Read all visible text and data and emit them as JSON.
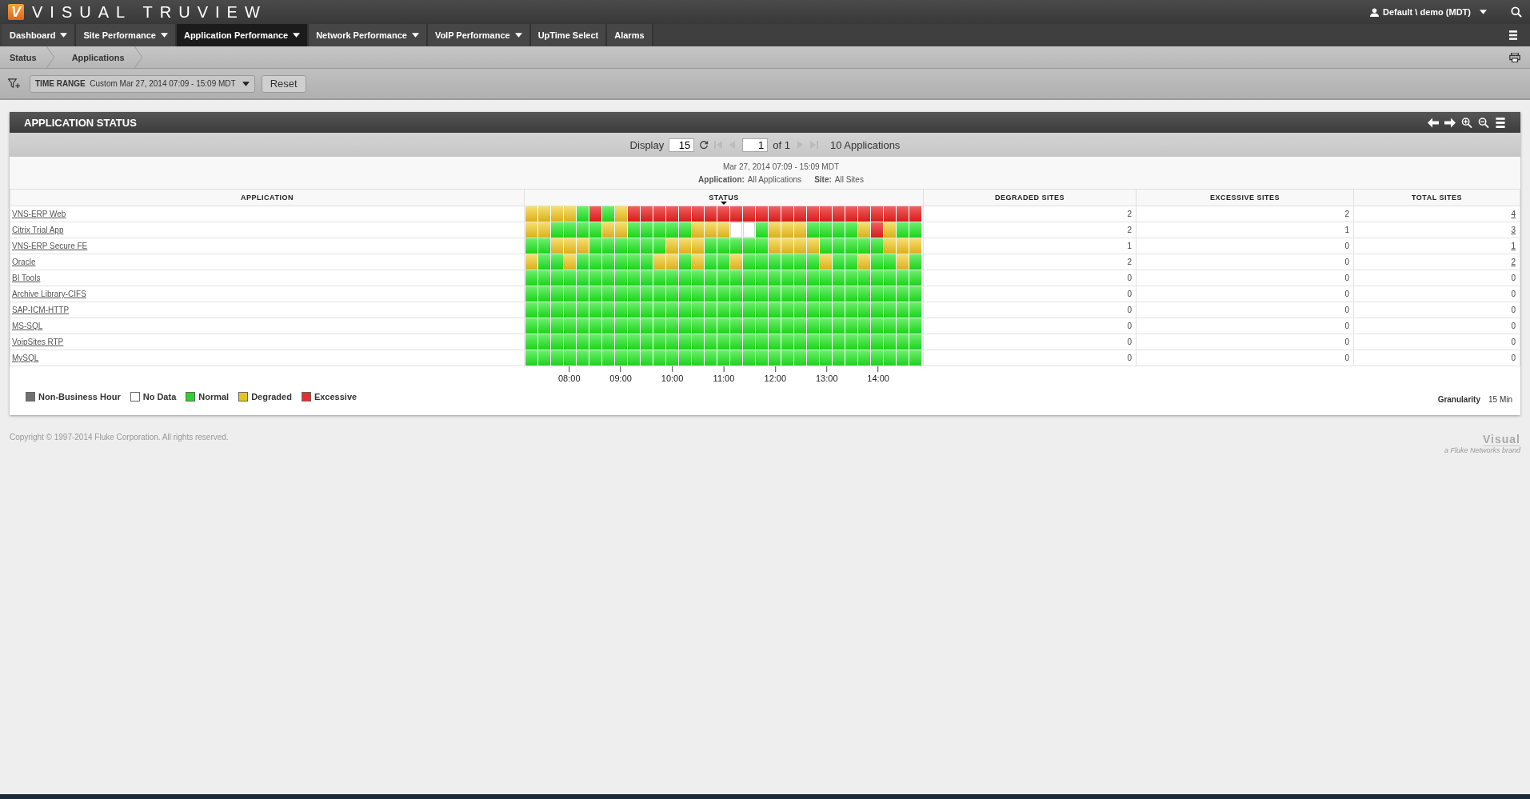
{
  "brand": {
    "logo_letter": "V",
    "title": "VISUAL TRUVIEW"
  },
  "user": {
    "label": "Default \\ demo (MDT)"
  },
  "nav": [
    {
      "label": "Dashboard",
      "dropdown": true,
      "selected": false
    },
    {
      "label": "Site Performance",
      "dropdown": true,
      "selected": false
    },
    {
      "label": "Application Performance",
      "dropdown": true,
      "selected": true
    },
    {
      "label": "Network Performance",
      "dropdown": true,
      "selected": false
    },
    {
      "label": "VoIP Performance",
      "dropdown": true,
      "selected": false
    },
    {
      "label": "UpTime Select",
      "dropdown": false,
      "selected": false
    },
    {
      "label": "Alarms",
      "dropdown": false,
      "selected": false
    }
  ],
  "breadcrumb": [
    "Status",
    "Applications"
  ],
  "filter": {
    "label": "TIME RANGE",
    "value": "Custom Mar 27, 2014 07:09 - 15:09 MDT",
    "reset": "Reset"
  },
  "panel": {
    "title": "APPLICATION STATUS",
    "pager": {
      "display_label": "Display",
      "display_value": "15",
      "page_value": "1",
      "page_of": "of 1",
      "count": "10 Applications"
    },
    "info": {
      "date": "Mar 27, 2014 07:09 - 15:09 MDT",
      "application_label": "Application:",
      "application_value": "All Applications",
      "site_label": "Site:",
      "site_value": "All Sites"
    },
    "columns": [
      "APPLICATION",
      "STATUS",
      "DEGRADED SITES",
      "EXCESSIVE SITES",
      "TOTAL SITES"
    ],
    "rows": [
      {
        "application": "VNS-ERP Web",
        "degraded": "2",
        "excessive": "2",
        "total": "4",
        "total_link": true,
        "cells": [
          {
            "kind": "degraded"
          },
          {
            "kind": "degraded"
          },
          {
            "kind": "degraded"
          },
          {
            "kind": "degraded"
          },
          {
            "kind": "normal"
          },
          {
            "kind": "excessive"
          },
          {
            "kind": "normal"
          },
          {
            "kind": "degraded"
          },
          {
            "kind": "excessive"
          },
          {
            "kind": "excessive"
          },
          {
            "kind": "excessive"
          },
          {
            "kind": "excessive"
          },
          {
            "kind": "excessive"
          },
          {
            "kind": "excessive"
          },
          {
            "kind": "excessive"
          },
          {
            "kind": "excessive"
          },
          {
            "kind": "excessive"
          },
          {
            "kind": "excessive"
          },
          {
            "kind": "excessive"
          },
          {
            "kind": "excessive"
          },
          {
            "kind": "excessive"
          },
          {
            "kind": "excessive"
          },
          {
            "kind": "excessive"
          },
          {
            "kind": "excessive"
          },
          {
            "kind": "excessive"
          },
          {
            "kind": "excessive"
          },
          {
            "kind": "excessive"
          },
          {
            "kind": "excessive"
          },
          {
            "kind": "excessive"
          },
          {
            "kind": "excessive"
          },
          {
            "kind": "excessive"
          }
        ]
      },
      {
        "application": "Citrix Trial App",
        "degraded": "2",
        "excessive": "1",
        "total": "3",
        "total_link": true,
        "cells": [
          {
            "kind": "degraded"
          },
          {
            "kind": "degraded"
          },
          {
            "kind": "normal"
          },
          {
            "kind": "normal"
          },
          {
            "kind": "normal"
          },
          {
            "kind": "normal"
          },
          {
            "kind": "degraded"
          },
          {
            "kind": "degraded"
          },
          {
            "kind": "normal"
          },
          {
            "kind": "normal"
          },
          {
            "kind": "normal"
          },
          {
            "kind": "normal"
          },
          {
            "kind": "normal"
          },
          {
            "kind": "degraded"
          },
          {
            "kind": "degraded"
          },
          {
            "kind": "degraded"
          },
          {
            "kind": "empty"
          },
          {
            "kind": "empty"
          },
          {
            "kind": "normal"
          },
          {
            "kind": "degraded"
          },
          {
            "kind": "degraded"
          },
          {
            "kind": "degraded"
          },
          {
            "kind": "normal"
          },
          {
            "kind": "normal"
          },
          {
            "kind": "normal"
          },
          {
            "kind": "normal"
          },
          {
            "kind": "degraded"
          },
          {
            "kind": "excessive"
          },
          {
            "kind": "degraded"
          },
          {
            "kind": "normal"
          },
          {
            "kind": "normal"
          }
        ]
      },
      {
        "application": "VNS-ERP Secure FE",
        "degraded": "1",
        "excessive": "0",
        "total": "1",
        "total_link": true,
        "cells": [
          {
            "kind": "normal"
          },
          {
            "kind": "normal"
          },
          {
            "kind": "degraded"
          },
          {
            "kind": "degraded"
          },
          {
            "kind": "degraded"
          },
          {
            "kind": "normal"
          },
          {
            "kind": "normal"
          },
          {
            "kind": "normal"
          },
          {
            "kind": "normal"
          },
          {
            "kind": "normal"
          },
          {
            "kind": "normal"
          },
          {
            "kind": "degraded"
          },
          {
            "kind": "degraded"
          },
          {
            "kind": "degraded"
          },
          {
            "kind": "normal"
          },
          {
            "kind": "normal"
          },
          {
            "kind": "normal"
          },
          {
            "kind": "normal"
          },
          {
            "kind": "normal"
          },
          {
            "kind": "degraded"
          },
          {
            "kind": "degraded"
          },
          {
            "kind": "degraded"
          },
          {
            "kind": "degraded"
          },
          {
            "kind": "normal"
          },
          {
            "kind": "normal"
          },
          {
            "kind": "normal"
          },
          {
            "kind": "normal"
          },
          {
            "kind": "normal"
          },
          {
            "kind": "degraded"
          },
          {
            "kind": "degraded"
          },
          {
            "kind": "degraded"
          }
        ]
      },
      {
        "application": "Oracle",
        "degraded": "2",
        "excessive": "0",
        "total": "2",
        "total_link": true,
        "cells": [
          {
            "kind": "degraded"
          },
          {
            "kind": "normal"
          },
          {
            "kind": "normal"
          },
          {
            "kind": "degraded"
          },
          {
            "kind": "normal"
          },
          {
            "kind": "normal"
          },
          {
            "kind": "normal"
          },
          {
            "kind": "normal"
          },
          {
            "kind": "normal"
          },
          {
            "kind": "normal"
          },
          {
            "kind": "degraded"
          },
          {
            "kind": "degraded"
          },
          {
            "kind": "normal"
          },
          {
            "kind": "degraded"
          },
          {
            "kind": "normal"
          },
          {
            "kind": "normal"
          },
          {
            "kind": "degraded"
          },
          {
            "kind": "normal"
          },
          {
            "kind": "normal"
          },
          {
            "kind": "normal"
          },
          {
            "kind": "normal"
          },
          {
            "kind": "normal"
          },
          {
            "kind": "normal"
          },
          {
            "kind": "degraded"
          },
          {
            "kind": "normal"
          },
          {
            "kind": "normal"
          },
          {
            "kind": "degraded"
          },
          {
            "kind": "normal"
          },
          {
            "kind": "normal"
          },
          {
            "kind": "degraded"
          },
          {
            "kind": "normal"
          }
        ]
      },
      {
        "application": "BI Tools",
        "degraded": "0",
        "excessive": "0",
        "total": "0",
        "total_link": false,
        "cells": [
          {
            "kind": "normal"
          },
          {
            "kind": "normal"
          },
          {
            "kind": "normal"
          },
          {
            "kind": "normal"
          },
          {
            "kind": "normal"
          },
          {
            "kind": "normal"
          },
          {
            "kind": "normal"
          },
          {
            "kind": "normal"
          },
          {
            "kind": "normal"
          },
          {
            "kind": "normal"
          },
          {
            "kind": "normal"
          },
          {
            "kind": "normal"
          },
          {
            "kind": "normal"
          },
          {
            "kind": "normal"
          },
          {
            "kind": "normal"
          },
          {
            "kind": "normal"
          },
          {
            "kind": "normal"
          },
          {
            "kind": "normal"
          },
          {
            "kind": "normal"
          },
          {
            "kind": "normal"
          },
          {
            "kind": "normal"
          },
          {
            "kind": "normal"
          },
          {
            "kind": "normal"
          },
          {
            "kind": "normal"
          },
          {
            "kind": "normal"
          },
          {
            "kind": "normal"
          },
          {
            "kind": "normal"
          },
          {
            "kind": "normal"
          },
          {
            "kind": "normal"
          },
          {
            "kind": "normal"
          },
          {
            "kind": "normal"
          }
        ]
      },
      {
        "application": "Archive Library-CIFS",
        "degraded": "0",
        "excessive": "0",
        "total": "0",
        "total_link": false,
        "cells": [
          {
            "kind": "normal"
          },
          {
            "kind": "normal"
          },
          {
            "kind": "normal"
          },
          {
            "kind": "normal"
          },
          {
            "kind": "normal"
          },
          {
            "kind": "normal"
          },
          {
            "kind": "normal"
          },
          {
            "kind": "normal"
          },
          {
            "kind": "normal"
          },
          {
            "kind": "normal"
          },
          {
            "kind": "normal"
          },
          {
            "kind": "normal"
          },
          {
            "kind": "normal"
          },
          {
            "kind": "normal"
          },
          {
            "kind": "normal"
          },
          {
            "kind": "normal"
          },
          {
            "kind": "normal"
          },
          {
            "kind": "normal"
          },
          {
            "kind": "normal"
          },
          {
            "kind": "normal"
          },
          {
            "kind": "normal"
          },
          {
            "kind": "normal"
          },
          {
            "kind": "normal"
          },
          {
            "kind": "normal"
          },
          {
            "kind": "normal"
          },
          {
            "kind": "normal"
          },
          {
            "kind": "normal"
          },
          {
            "kind": "normal"
          },
          {
            "kind": "normal"
          },
          {
            "kind": "normal"
          },
          {
            "kind": "normal"
          }
        ]
      },
      {
        "application": "SAP-ICM-HTTP",
        "degraded": "0",
        "excessive": "0",
        "total": "0",
        "total_link": false,
        "cells": [
          {
            "kind": "normal"
          },
          {
            "kind": "normal"
          },
          {
            "kind": "normal"
          },
          {
            "kind": "normal"
          },
          {
            "kind": "normal"
          },
          {
            "kind": "normal"
          },
          {
            "kind": "normal"
          },
          {
            "kind": "normal"
          },
          {
            "kind": "normal"
          },
          {
            "kind": "normal"
          },
          {
            "kind": "normal"
          },
          {
            "kind": "normal"
          },
          {
            "kind": "normal"
          },
          {
            "kind": "normal"
          },
          {
            "kind": "normal"
          },
          {
            "kind": "normal"
          },
          {
            "kind": "normal"
          },
          {
            "kind": "normal"
          },
          {
            "kind": "normal"
          },
          {
            "kind": "normal"
          },
          {
            "kind": "normal"
          },
          {
            "kind": "normal"
          },
          {
            "kind": "normal"
          },
          {
            "kind": "normal"
          },
          {
            "kind": "normal"
          },
          {
            "kind": "normal"
          },
          {
            "kind": "normal"
          },
          {
            "kind": "normal"
          },
          {
            "kind": "normal"
          },
          {
            "kind": "normal"
          },
          {
            "kind": "normal"
          }
        ]
      },
      {
        "application": "MS-SQL",
        "degraded": "0",
        "excessive": "0",
        "total": "0",
        "total_link": false,
        "cells": [
          {
            "kind": "normal"
          },
          {
            "kind": "normal"
          },
          {
            "kind": "normal"
          },
          {
            "kind": "normal"
          },
          {
            "kind": "normal"
          },
          {
            "kind": "normal"
          },
          {
            "kind": "normal"
          },
          {
            "kind": "normal"
          },
          {
            "kind": "normal"
          },
          {
            "kind": "normal"
          },
          {
            "kind": "normal"
          },
          {
            "kind": "normal"
          },
          {
            "kind": "normal"
          },
          {
            "kind": "normal"
          },
          {
            "kind": "normal"
          },
          {
            "kind": "normal"
          },
          {
            "kind": "normal"
          },
          {
            "kind": "normal"
          },
          {
            "kind": "normal"
          },
          {
            "kind": "normal"
          },
          {
            "kind": "normal"
          },
          {
            "kind": "normal"
          },
          {
            "kind": "normal"
          },
          {
            "kind": "normal"
          },
          {
            "kind": "normal"
          },
          {
            "kind": "normal"
          },
          {
            "kind": "normal"
          },
          {
            "kind": "normal"
          },
          {
            "kind": "normal"
          },
          {
            "kind": "normal"
          },
          {
            "kind": "normal"
          }
        ]
      },
      {
        "application": "VoipSites RTP",
        "degraded": "0",
        "excessive": "0",
        "total": "0",
        "total_link": false,
        "cells": [
          {
            "kind": "normal"
          },
          {
            "kind": "normal"
          },
          {
            "kind": "normal"
          },
          {
            "kind": "normal"
          },
          {
            "kind": "normal"
          },
          {
            "kind": "normal"
          },
          {
            "kind": "normal"
          },
          {
            "kind": "normal"
          },
          {
            "kind": "normal"
          },
          {
            "kind": "normal"
          },
          {
            "kind": "normal"
          },
          {
            "kind": "normal"
          },
          {
            "kind": "normal"
          },
          {
            "kind": "normal"
          },
          {
            "kind": "normal"
          },
          {
            "kind": "normal"
          },
          {
            "kind": "normal"
          },
          {
            "kind": "normal"
          },
          {
            "kind": "normal"
          },
          {
            "kind": "normal"
          },
          {
            "kind": "normal"
          },
          {
            "kind": "normal"
          },
          {
            "kind": "normal"
          },
          {
            "kind": "normal"
          },
          {
            "kind": "normal"
          },
          {
            "kind": "normal"
          },
          {
            "kind": "normal"
          },
          {
            "kind": "normal"
          },
          {
            "kind": "normal"
          },
          {
            "kind": "normal"
          },
          {
            "kind": "normal"
          }
        ]
      },
      {
        "application": "MySQL",
        "degraded": "0",
        "excessive": "0",
        "total": "0",
        "total_link": false,
        "cells": [
          {
            "kind": "normal"
          },
          {
            "kind": "normal"
          },
          {
            "kind": "normal"
          },
          {
            "kind": "normal"
          },
          {
            "kind": "normal"
          },
          {
            "kind": "normal"
          },
          {
            "kind": "normal"
          },
          {
            "kind": "normal"
          },
          {
            "kind": "normal"
          },
          {
            "kind": "normal"
          },
          {
            "kind": "normal"
          },
          {
            "kind": "normal"
          },
          {
            "kind": "normal"
          },
          {
            "kind": "normal"
          },
          {
            "kind": "normal"
          },
          {
            "kind": "normal"
          },
          {
            "kind": "normal"
          },
          {
            "kind": "normal"
          },
          {
            "kind": "normal"
          },
          {
            "kind": "normal"
          },
          {
            "kind": "normal"
          },
          {
            "kind": "normal"
          },
          {
            "kind": "normal"
          },
          {
            "kind": "normal"
          },
          {
            "kind": "normal"
          },
          {
            "kind": "normal"
          },
          {
            "kind": "normal"
          },
          {
            "kind": "normal"
          },
          {
            "kind": "normal"
          },
          {
            "kind": "normal"
          },
          {
            "kind": "normal"
          }
        ]
      }
    ],
    "time_axis": [
      "08:00",
      "09:00",
      "10:00",
      "11:00",
      "12:00",
      "13:00",
      "14:00"
    ],
    "legend": [
      {
        "label": "Non-Business Hour",
        "color": "#707070"
      },
      {
        "label": "No Data",
        "color": "#ffffff"
      },
      {
        "label": "Normal",
        "color": "#2ed12e"
      },
      {
        "label": "Degraded",
        "color": "#e4c22c"
      },
      {
        "label": "Excessive",
        "color": "#e03030"
      }
    ],
    "granularity": {
      "label": "Granularity",
      "value": "15 Min"
    }
  },
  "footer": {
    "copyright": "Copyright © 1997-2014 Fluke Corporation. All rights reserved.",
    "brand": "Visual",
    "brand_sub": "a Fluke Networks brand"
  }
}
